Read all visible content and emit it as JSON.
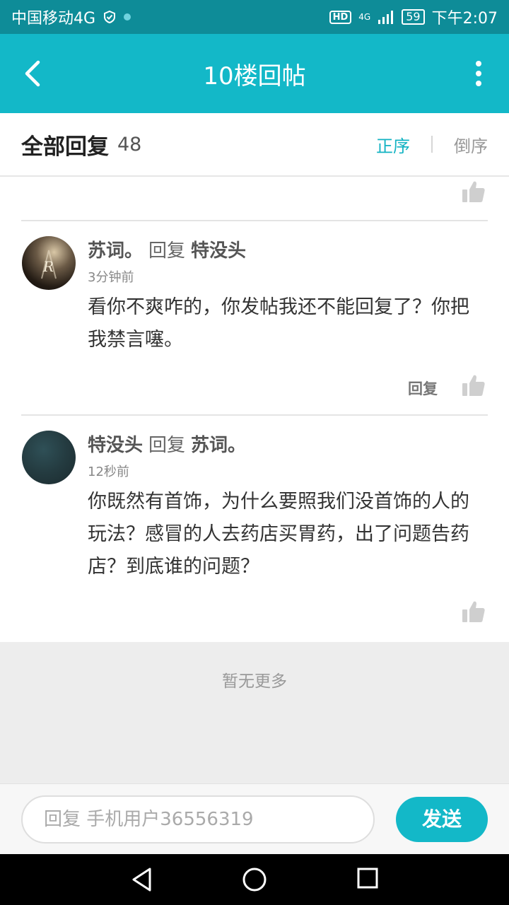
{
  "status_bar": {
    "carrier": "中国移动4G",
    "hd": "HD",
    "network": "4G",
    "battery": "59",
    "time": "下午2:07"
  },
  "title_bar": {
    "title": "10楼回帖",
    "back_icon": "chevron-left-icon",
    "more_icon": "more-vertical-icon"
  },
  "sort_bar": {
    "heading": "全部回复",
    "count": "48",
    "asc_label": "正序",
    "desc_label": "倒序",
    "active_color": "#13b3c3"
  },
  "replies": [
    {
      "author": "苏词。",
      "verb": "回复",
      "target": "特没头",
      "time": "3分钟前",
      "text": "看你不爽咋的，你发帖我还不能回复了？你把我禁言噻。",
      "reply_label": "回复"
    },
    {
      "author": "特没头",
      "verb": "回复",
      "target": "苏词。",
      "time": "12秒前",
      "text": "你既然有首饰，为什么要照我们没首饰的人的玩法？感冒的人去药店买胃药，出了问题告药店？到底谁的问题？"
    }
  ],
  "footer": {
    "no_more": "暂无更多"
  },
  "input_bar": {
    "placeholder": "回复 手机用户36556319",
    "send_label": "发送",
    "accent": "#13b8c8"
  },
  "nav_bar": {
    "back_icon": "triangle-back-icon",
    "home_icon": "circle-home-icon",
    "recent_icon": "square-recent-icon"
  }
}
